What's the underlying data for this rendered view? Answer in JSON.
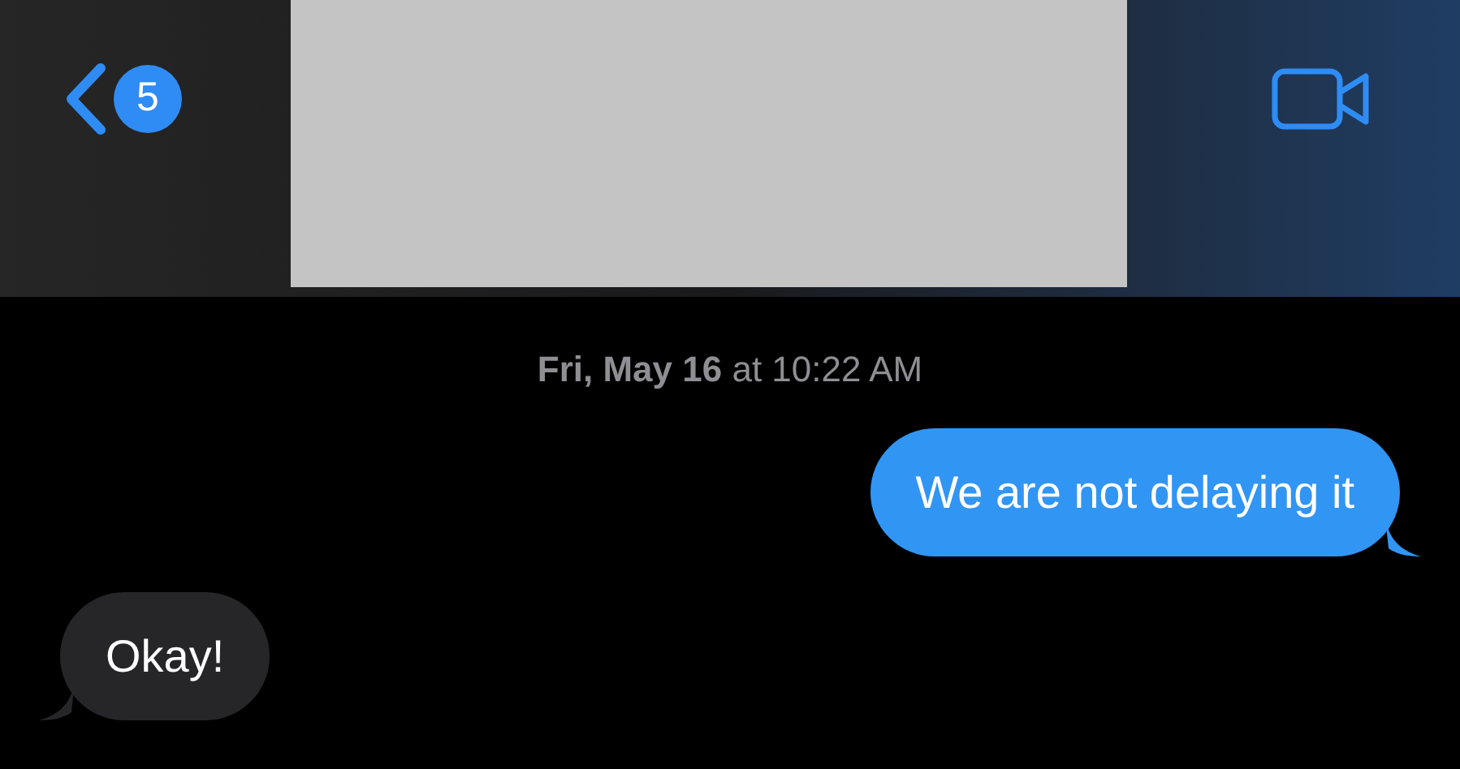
{
  "header": {
    "back_badge": "5"
  },
  "timestamp": "**Fri, May 16** at 10:22 AM",
  "messages": [
    {
      "kind": "outgoing",
      "text": "We are not delaying it"
    },
    {
      "kind": "incoming",
      "text": "Okay!"
    }
  ]
}
